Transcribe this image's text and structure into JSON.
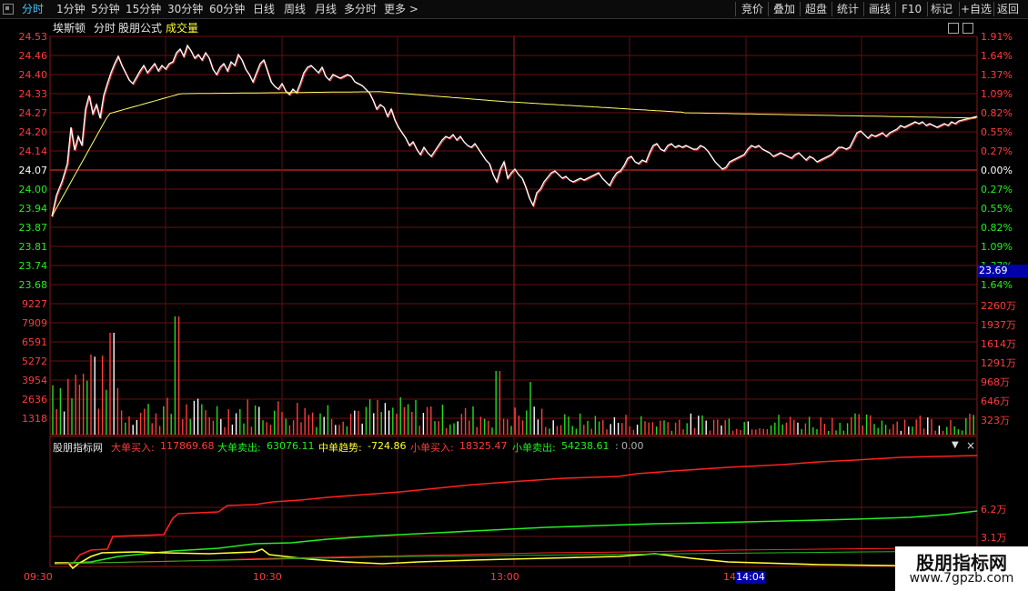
{
  "colors": {
    "up": "#ff3c3c",
    "down": "#22ee22",
    "flat": "#ffffff",
    "accent": "#3fc6ff",
    "avg_line": "#ffff66",
    "time_tag_bg": "#0000a8"
  },
  "topbar": {
    "left_tabs": [
      "分时",
      "1分钟",
      "5分钟",
      "15分钟",
      "30分钟",
      "60分钟",
      "日线",
      "周线",
      "月线",
      "多分时",
      "更多 >"
    ],
    "active": "分时",
    "right_tabs": [
      "竞价",
      "叠加",
      "超盘",
      "统计",
      "画线",
      "F10",
      "+自选",
      "标记",
      "返回"
    ]
  },
  "title": {
    "stock_name": "埃斯顿",
    "mode": "分时",
    "formula": "股朋公式",
    "overlay": "成交量"
  },
  "price_axis": {
    "left": [
      "24.53",
      "24.46",
      "24.40",
      "24.33",
      "24.27",
      "24.20",
      "24.14",
      "24.07",
      "24.00",
      "23.94",
      "23.87",
      "23.81",
      "23.74",
      "23.68"
    ],
    "right": [
      "1.91%",
      "1.64%",
      "1.37%",
      "1.09%",
      "0.82%",
      "0.55%",
      "0.27%",
      "0.00%",
      "0.27%",
      "0.55%",
      "0.82%",
      "1.09%",
      "1.37%",
      "1.64%"
    ]
  },
  "volume_axis": {
    "left": [
      "9227",
      "7909",
      "6591",
      "5272",
      "3954",
      "2636",
      "1318"
    ],
    "right": [
      "2260万",
      "1937万",
      "1614万",
      "1291万",
      "968万",
      "646万",
      "323万"
    ]
  },
  "current_price_tag": "23.69",
  "indicator": {
    "name": "股朋指标网",
    "items": [
      {
        "label": "大单买入:",
        "value": "117869.68",
        "color": "red"
      },
      {
        "label": "大单卖出:",
        "value": "63076.11",
        "color": "green"
      },
      {
        "label": "中单趋势:",
        "value": "-724.86",
        "color": "yellow"
      },
      {
        "label": "小单买入:",
        "value": "18325.47",
        "color": "red"
      },
      {
        "label": "小单卖出:",
        "value": "54238.61",
        "color": "green"
      },
      {
        "label": ":",
        "value": "0.00",
        "color": "gray"
      }
    ],
    "right_axis": [
      "6.2万",
      "3.1万"
    ]
  },
  "time_axis": [
    "09:30",
    "10:30",
    "13:00",
    "14"
  ],
  "cursor_time": "14:04",
  "watermark": {
    "site": "股朋指标网",
    "url": "www.7gpzb.com"
  }
}
